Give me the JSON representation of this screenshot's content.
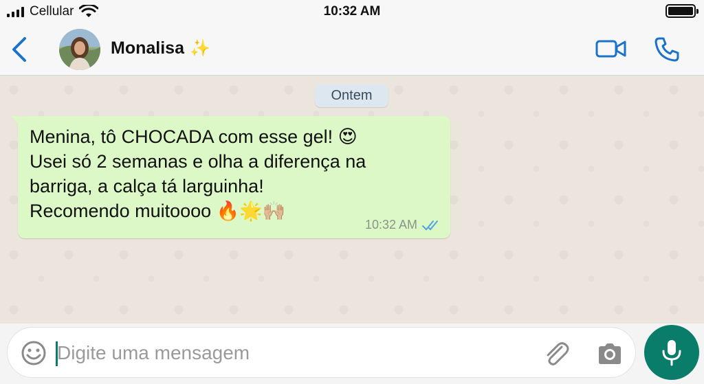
{
  "status_bar": {
    "carrier": "Cellular",
    "time": "10:32 AM",
    "icons": [
      "signal-icon",
      "wifi-icon",
      "battery-icon"
    ]
  },
  "header": {
    "contact_name": "Monalisa",
    "name_emoji": "✨",
    "icons": [
      "back-chevron-icon",
      "video-call-icon",
      "phone-icon"
    ],
    "accent_color": "#1a73c9"
  },
  "chat": {
    "date_chip": "Ontem",
    "messages": [
      {
        "lines": [
          "Menina, tô CHOCADA com esse gel! 😍",
          "Usei só 2 semanas e olha a diferença na",
          "barriga, a calça tá larguinha!",
          "Recomendo muitoooo 🔥🌟🙌🏼"
        ],
        "time": "10:32 AM",
        "status": "read-double-check"
      }
    ],
    "bubble_color": "#dcf8c6",
    "background_color": "#ece5dd"
  },
  "input_bar": {
    "placeholder": "Digite uma mensagem",
    "value": "",
    "icons": [
      "emoji-icon",
      "paperclip-icon",
      "camera-icon",
      "microphone-icon"
    ],
    "mic_color": "#0a7c6a"
  }
}
